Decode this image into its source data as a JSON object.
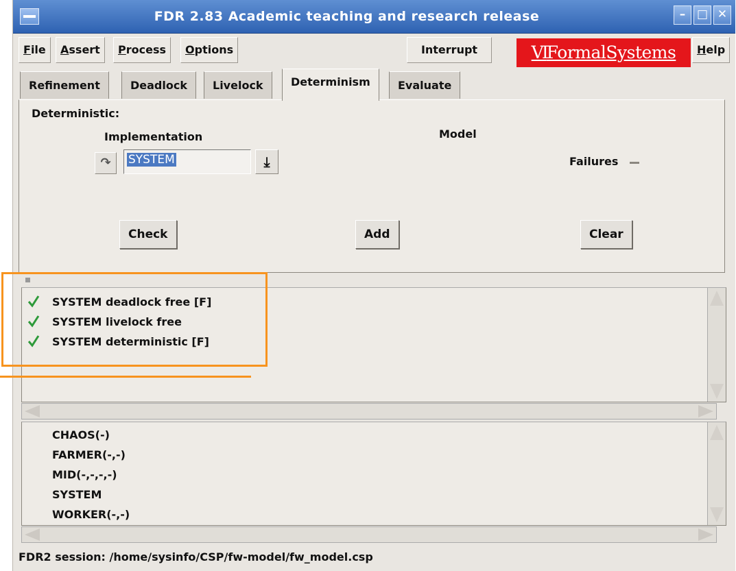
{
  "window": {
    "title": "FDR 2.83 Academic teaching and research release",
    "controls": [
      "minimize-icon",
      "maximize-icon",
      "close-icon"
    ]
  },
  "menubar": {
    "file": "File",
    "assert": "Assert",
    "process": "Process",
    "options": "Options",
    "interrupt": "Interrupt",
    "logo": "FormalSystems",
    "help": "Help"
  },
  "tabs": [
    {
      "label": "Refinement"
    },
    {
      "label": "Deadlock"
    },
    {
      "label": "Livelock"
    },
    {
      "label": "Determinism",
      "active": true
    },
    {
      "label": "Evaluate"
    }
  ],
  "panel": {
    "heading": "Deterministic:",
    "implementation_label": "Implementation",
    "implementation_value": "SYSTEM",
    "model_label": "Model",
    "model_value": "Failures",
    "buttons": {
      "check": "Check",
      "add": "Add",
      "clear": "Clear"
    }
  },
  "results": [
    {
      "text": "SYSTEM deadlock free [F]",
      "status": "passed"
    },
    {
      "text": "SYSTEM livelock free",
      "status": "passed"
    },
    {
      "text": "SYSTEM deterministic [F]",
      "status": "passed"
    }
  ],
  "processes": [
    "CHAOS(-)",
    "FARMER(-,-)",
    "MID(-,-,-,-)",
    "SYSTEM",
    "WORKER(-,-)"
  ],
  "status_bar": "FDR2 session: /home/sysinfo/CSP/fw-model/fw_model.csp",
  "colors": {
    "titlebar": "#3c6fbf",
    "logo_bg": "#e4161b",
    "check": "#2e9a3a",
    "highlight": "#f7931e"
  }
}
